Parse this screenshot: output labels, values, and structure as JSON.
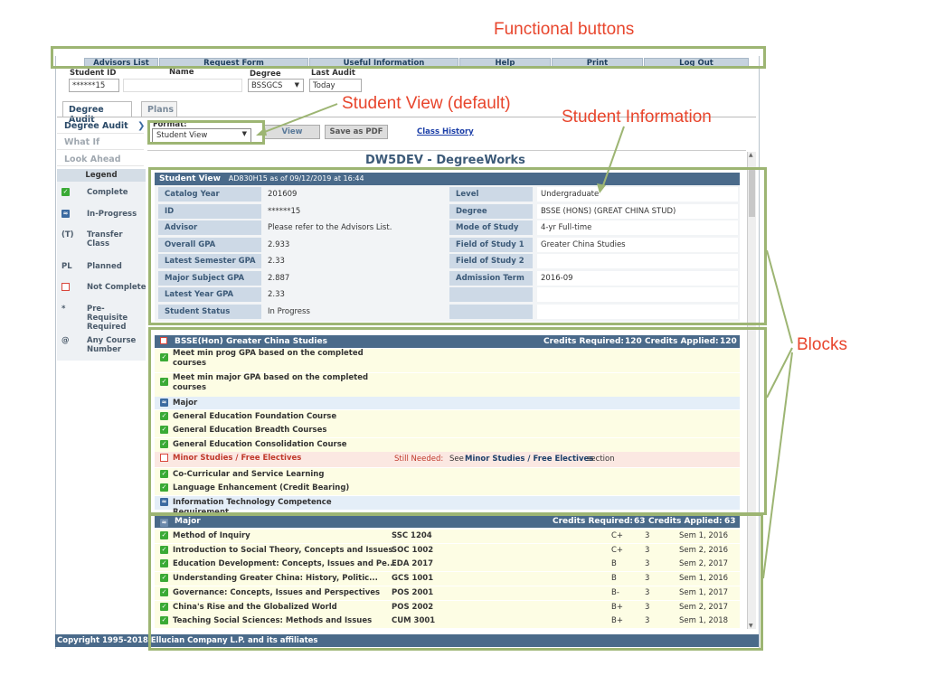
{
  "annotations": {
    "functional_buttons": "Functional buttons",
    "student_view_default": "Student View (default)",
    "student_information": "Student Information",
    "blocks": "Blocks"
  },
  "colors": {
    "annotation_red": "#e8452c",
    "annotation_green": "#9db573",
    "header_blue": "#4a6a8a",
    "label_cell": "#cdd9e6"
  },
  "topnav": [
    "Advisors List",
    "Request Form",
    "Useful Information",
    "Help",
    "Print",
    "Log Out"
  ],
  "student_header": {
    "id_label": "Student ID",
    "id_value": "******15",
    "name_label": "Name",
    "name_value": "",
    "degree_label": "Degree",
    "degree_value": "BSSGCS",
    "last_audit_label": "Last Audit",
    "last_audit_value": "Today"
  },
  "tabs": {
    "degree_audit": "Degree Audit",
    "plans": "Plans"
  },
  "side_nav": [
    "Degree Audit",
    "What If",
    "Look Ahead"
  ],
  "toolbar": {
    "format_label": "Format:",
    "format_value": "Student View",
    "view": "View",
    "save_pdf": "Save as PDF",
    "class_history": "Class History"
  },
  "app_title": "DW5DEV - DegreeWorks",
  "legend": {
    "title": "Legend",
    "items": [
      {
        "symbol": "check-icon",
        "label": "Complete"
      },
      {
        "symbol": "in-progress-icon",
        "label": "In-Progress"
      },
      {
        "symbol": "(T)",
        "label": "Transfer Class"
      },
      {
        "symbol": "PL",
        "label": "Planned"
      },
      {
        "symbol": "not-complete-icon",
        "label": "Not Complete"
      },
      {
        "symbol": "*",
        "label": "Pre-Requisite Required"
      },
      {
        "symbol": "@",
        "label": "Any Course Number"
      }
    ]
  },
  "student_view": {
    "title": "Student View",
    "subtitle": "AD830H15 as of 09/12/2019 at 16:44",
    "left": [
      {
        "label": "Catalog Year",
        "value": "201609"
      },
      {
        "label": "ID",
        "value": "******15"
      },
      {
        "label": "Advisor",
        "value": "Please refer to the Advisors List."
      },
      {
        "label": "Overall GPA",
        "value": "2.933"
      },
      {
        "label": "Latest Semester GPA",
        "value": "2.33"
      },
      {
        "label": "Major Subject GPA",
        "value": "2.887"
      },
      {
        "label": "Latest Year GPA",
        "value": "2.33"
      },
      {
        "label": "Student Status",
        "value": "In Progress"
      }
    ],
    "right": [
      {
        "label": "Level",
        "value": "Undergraduate"
      },
      {
        "label": "Degree",
        "value": "BSSE (HONS) (GREAT CHINA STUD)"
      },
      {
        "label": "Mode of Study",
        "value": "4-yr Full-time"
      },
      {
        "label": "Field of Study 1",
        "value": "Greater China Studies"
      },
      {
        "label": "Field of Study 2",
        "value": ""
      },
      {
        "label": "Admission Term",
        "value": "2016-09"
      },
      {
        "label": "",
        "value": ""
      },
      {
        "label": "",
        "value": ""
      }
    ]
  },
  "block1": {
    "title": "BSSE(Hon) Greater China Studies",
    "credits_required_label": "Credits Required:",
    "credits_required": "120",
    "credits_applied_label": "Credits Applied:",
    "credits_applied": "120",
    "rows": [
      {
        "status": "complete",
        "text": "Meet min prog GPA based on the completed courses"
      },
      {
        "status": "complete",
        "text": "Meet min major GPA based on the completed courses"
      },
      {
        "status": "in-progress",
        "text": "Major"
      },
      {
        "status": "complete",
        "text": "General Education Foundation Course"
      },
      {
        "status": "complete",
        "text": "General Education Breadth Courses"
      },
      {
        "status": "complete",
        "text": "General Education Consolidation Course"
      },
      {
        "status": "not-complete",
        "text": "Minor Studies / Free Electives",
        "still_needed": "Still Needed:",
        "see": "See",
        "see_bold": "Minor Studies / Free Electives",
        "see_after": "section"
      },
      {
        "status": "complete",
        "text": "Co-Curricular and Service Learning"
      },
      {
        "status": "complete",
        "text": "Language Enhancement (Credit Bearing)"
      },
      {
        "status": "in-progress",
        "text": "Information Technology Competence Requirement"
      }
    ]
  },
  "block2": {
    "title": "Major",
    "credits_required_label": "Credits Required:",
    "credits_required": "63",
    "credits_applied_label": "Credits Applied:",
    "credits_applied": "63",
    "rows": [
      {
        "course": "Method of Inquiry",
        "code": "SSC 1204",
        "grade": "C+",
        "credits": "3",
        "term": "Sem 1, 2016"
      },
      {
        "course": "Introduction to Social Theory, Concepts and Issues",
        "code": "SOC 1002",
        "grade": "C+",
        "credits": "3",
        "term": "Sem 2, 2016"
      },
      {
        "course": "Education Development: Concepts, Issues and Pe...",
        "code": "EDA 2017",
        "grade": "B",
        "credits": "3",
        "term": "Sem 2, 2017"
      },
      {
        "course": "Understanding Greater China: History, Politic...",
        "code": "GCS 1001",
        "grade": "B",
        "credits": "3",
        "term": "Sem 1, 2016"
      },
      {
        "course": "Governance: Concepts, Issues and Perspectives",
        "code": "POS 2001",
        "grade": "B-",
        "credits": "3",
        "term": "Sem 1, 2017"
      },
      {
        "course": "China's Rise and the Globalized World",
        "code": "POS 2002",
        "grade": "B+",
        "credits": "3",
        "term": "Sem 2, 2017"
      },
      {
        "course": "Teaching Social Sciences: Methods and Issues",
        "code": "CUM 3001",
        "grade": "B+",
        "credits": "3",
        "term": "Sem 1, 2018"
      }
    ]
  },
  "footer": "Copyright 1995-2018 Ellucian Company L.P. and its affiliates"
}
